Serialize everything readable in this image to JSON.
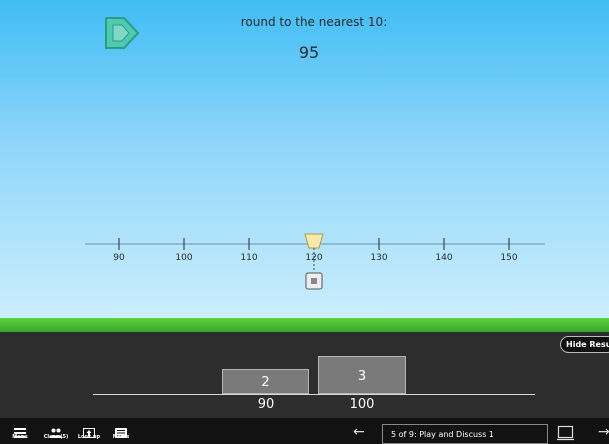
{
  "prompt": {
    "text": "round to the nearest 10:",
    "target_value": "95"
  },
  "number_line": {
    "ticks": [
      "90",
      "100",
      "110",
      "120",
      "130",
      "140",
      "150"
    ],
    "marker_value": 120
  },
  "results": {
    "hide_label": "Hide Results",
    "bars": [
      {
        "count": "2",
        "label": "90"
      },
      {
        "count": "3",
        "label": "100"
      }
    ]
  },
  "bottom_bar": {
    "menu": "Menu",
    "class": "Class (5)",
    "look_up": "Look up",
    "notes": "Notes",
    "page_indicator": "5 of 9: Play and Discuss 1"
  },
  "colors": {
    "sky_top": "#3fbdf5",
    "grass": "#4cc234",
    "results_bg": "#2d2d2d",
    "bar": "#7a7a7a",
    "play_icon": "#3fc2a6"
  }
}
